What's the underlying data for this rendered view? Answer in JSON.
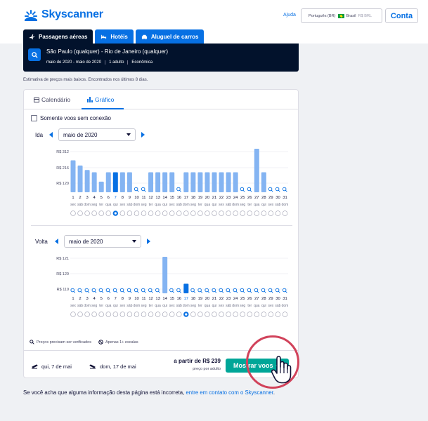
{
  "header": {
    "brand": "Skyscanner",
    "help": "Ajuda",
    "locale": {
      "language": "Português (BR)",
      "country": "Brasil",
      "currency": "R$ BRL"
    },
    "login": "Conta"
  },
  "tabs": [
    {
      "label": "Passagens aéreas",
      "icon": "plane-icon",
      "active": true
    },
    {
      "label": "Hotéis",
      "icon": "bed-icon",
      "active": false
    },
    {
      "label": "Aluguel de carros",
      "icon": "car-icon",
      "active": false
    }
  ],
  "search": {
    "route": "São Paulo (qualquer) - Rio de Janeiro (qualquer)",
    "dates": "maio de 2020 - maio de 2020",
    "travellers": "1 adulto",
    "cabin": "Econômica"
  },
  "estimate_note": "Estimativa de preços mais baixos. Encontrados nos últimos 8 dias.",
  "view_tabs": {
    "calendar": "Calendário",
    "graph": "Gráfico"
  },
  "nonstop_label": "Somente voos sem conexão",
  "outbound": {
    "label": "Ida",
    "month": "maio de 2020",
    "y_ticks": [
      "R$ 312",
      "R$ 216",
      "R$ 120"
    ],
    "days": [
      "1",
      "2",
      "3",
      "4",
      "5",
      "6",
      "7",
      "8",
      "9",
      "10",
      "11",
      "12",
      "13",
      "14",
      "15",
      "16",
      "17",
      "18",
      "19",
      "20",
      "21",
      "22",
      "23",
      "24",
      "25",
      "26",
      "27",
      "28",
      "29",
      "30",
      "31"
    ],
    "weekdays": [
      "sex",
      "sáb",
      "dom",
      "seg",
      "ter",
      "qua",
      "qui",
      "sex",
      "sáb",
      "dom",
      "seg",
      "ter",
      "qua",
      "qui",
      "sex",
      "sáb",
      "dom",
      "seg",
      "ter",
      "qua",
      "qui",
      "sex",
      "sáb",
      "dom",
      "seg",
      "ter",
      "qua",
      "qui",
      "sex",
      "sáb",
      "dom"
    ],
    "prices": [
      276,
      260,
      246,
      239,
      210,
      239,
      239,
      239,
      239,
      null,
      null,
      239,
      239,
      239,
      239,
      null,
      239,
      239,
      239,
      239,
      239,
      239,
      239,
      239,
      null,
      null,
      312,
      239,
      null,
      null,
      null
    ],
    "selected_day": "7"
  },
  "inbound": {
    "label": "Volta",
    "month": "maio de 2020",
    "y_ticks": [
      "R$ 121",
      "R$ 120",
      "R$ 119"
    ],
    "days": [
      "1",
      "2",
      "3",
      "4",
      "5",
      "6",
      "7",
      "8",
      "9",
      "10",
      "11",
      "12",
      "13",
      "14",
      "15",
      "16",
      "17",
      "18",
      "19",
      "20",
      "21",
      "22",
      "23",
      "24",
      "25",
      "26",
      "27",
      "28",
      "29",
      "30",
      "31"
    ],
    "weekdays": [
      "sex",
      "sáb",
      "dom",
      "seg",
      "ter",
      "qua",
      "qui",
      "sex",
      "sáb",
      "dom",
      "seg",
      "ter",
      "qua",
      "qui",
      "sex",
      "sáb",
      "dom",
      "seg",
      "ter",
      "qua",
      "qui",
      "sex",
      "sáb",
      "dom",
      "seg",
      "ter",
      "qua",
      "qui",
      "sex",
      "sáb",
      "dom"
    ],
    "prices": [
      null,
      null,
      null,
      null,
      null,
      null,
      null,
      null,
      null,
      null,
      null,
      null,
      null,
      121,
      null,
      null,
      119,
      null,
      null,
      null,
      null,
      null,
      null,
      null,
      null,
      null,
      null,
      null,
      null,
      null,
      null
    ],
    "selected_day": "17"
  },
  "legend": {
    "verify": "Preços precisam ser verificados",
    "stops": "Apenas 1+ escalas"
  },
  "footer": {
    "outbound_date": "qui, 7 de mai",
    "return_date": "dom, 17 de mai",
    "price": "a partir de R$ 239",
    "price_sub": "preço por adulto",
    "cta": "Mostrar voos"
  },
  "bottom_note": {
    "text": "Se você acha que alguma informação desta página está incorreta,",
    "link": "entre em contato com o Skyscanner",
    "end": "."
  },
  "colors": {
    "brand": "#0770e3",
    "navy": "#02122c",
    "bar": "#84b4f2",
    "bar_selected": "#0770e3",
    "cta": "#00a698",
    "highlight": "#d1435b"
  }
}
